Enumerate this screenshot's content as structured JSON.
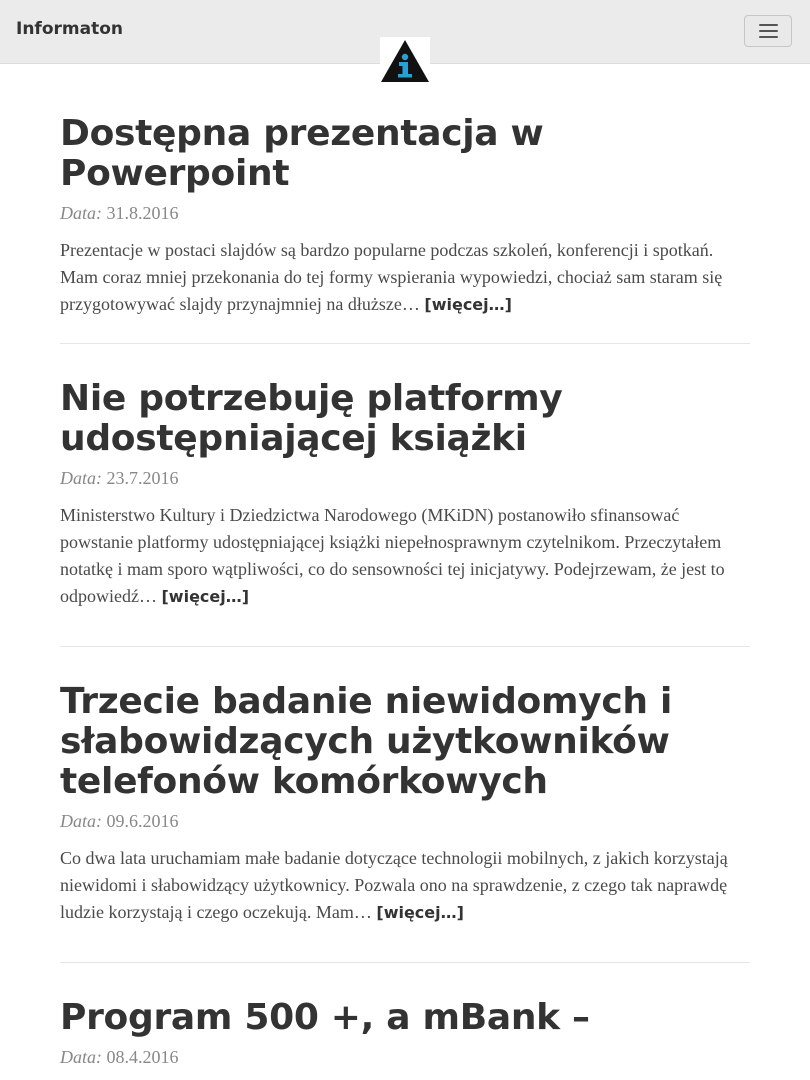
{
  "header": {
    "brand": "Informaton",
    "logo_icon": "info-triangle-logo",
    "logo_colors": {
      "triangle": "#111111",
      "letter": "#2a9fd6"
    },
    "menu_icon": "hamburger-icon"
  },
  "posts": [
    {
      "title": "Dostępna prezentacja w Powerpoint",
      "date_label": "Data:",
      "date": "31.8.2016",
      "excerpt": "Prezentacje w postaci slajdów są bardzo popularne podczas szkoleń, konferencji i spotkań. Mam coraz mniej przekonania do tej formy wspierania wypowiedzi, chociaż sam staram się przygotowywać slajdy przynajmniej na dłuższe…",
      "more": "[więcej…]"
    },
    {
      "title": "Nie potrzebuję platformy udostępniającej książki",
      "date_label": "Data:",
      "date": "23.7.2016",
      "excerpt": "Ministerstwo Kultury i Dziedzictwa Narodowego (MKiDN) postanowiło sfinansować powstanie platformy udostępniającej książki niepełnosprawnym czytelnikom. Przeczytałem notatkę i mam sporo wątpliwości, co do sensowności tej inicjatywy. Podejrzewam, że jest to odpowiedź…",
      "more": "[więcej…]"
    },
    {
      "title": "Trzecie badanie niewidomych i słabowidzących użytkowników telefonów komórkowych",
      "date_label": "Data:",
      "date": "09.6.2016",
      "excerpt": "Co dwa lata uruchamiam małe badanie dotyczące technologii mobilnych, z jakich korzystają niewidomi i słabowidzący użytkownicy. Pozwala ono na sprawdzenie, z czego tak naprawdę ludzie korzystają i czego oczekują. Mam…",
      "more": "[więcej…]"
    },
    {
      "title": "Program 500 +, a mBank –",
      "date_label": "Data:",
      "date": "08.4.2016"
    }
  ]
}
